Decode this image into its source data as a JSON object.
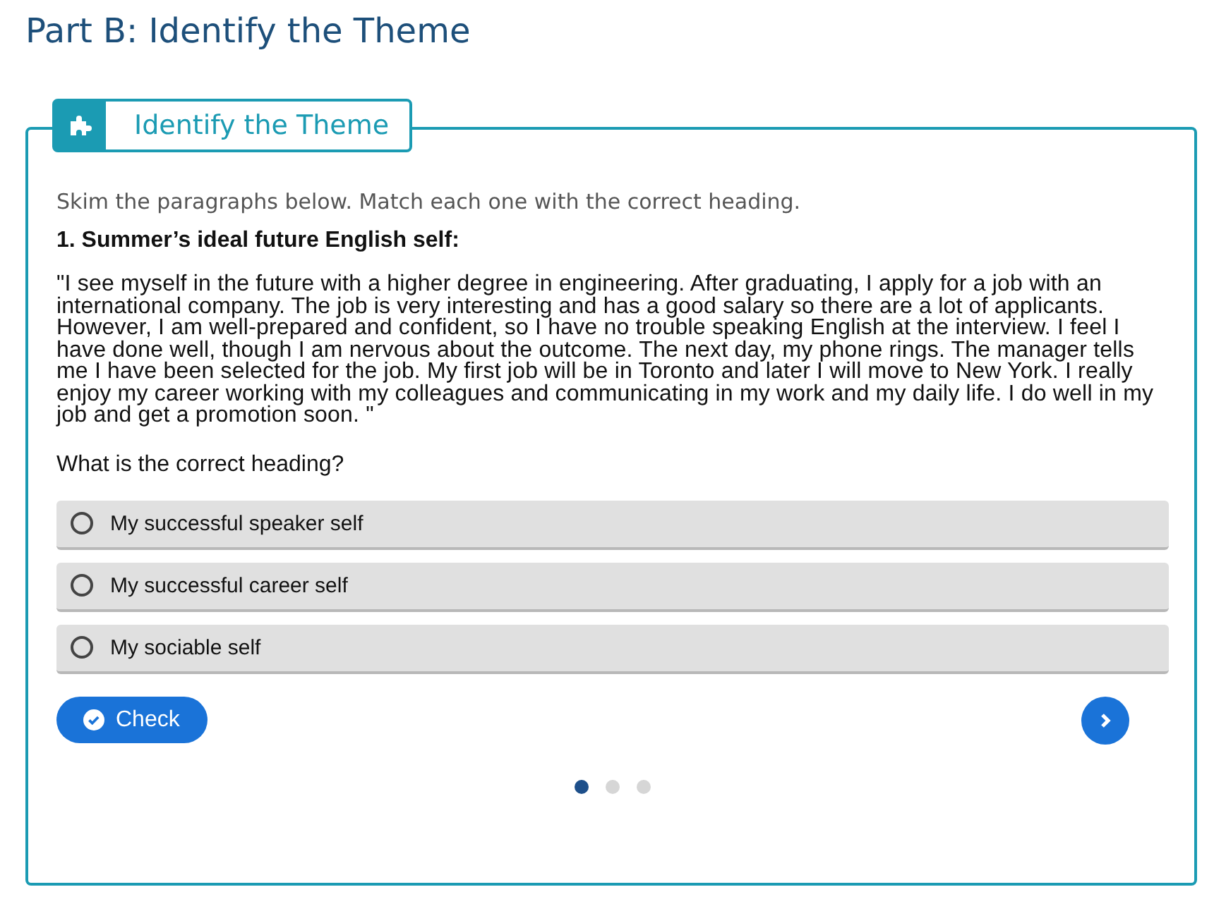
{
  "page_title": "Part B: Identify the Theme",
  "activity": {
    "title": "Identify the Theme",
    "instruction": "Skim the paragraphs below. Match each one with the correct heading.",
    "question_title": "1. Summer’s ideal future English self:",
    "passage": "\"I see myself in the future with a higher degree in engineering. After graduating, I apply for a job with an international company. The job is very interesting and has a good salary so there are a lot of applicants. However, I am well-prepared and confident, so I have no trouble speaking English at the interview. I feel I have done well, though I am nervous about the outcome. The next day, my phone rings. The manager tells me I have been selected for the job. My first job will be in Toronto and later I will move to New York. I really enjoy my career working with my colleagues and communicating in my work and my daily life. I do well in my job and get a promotion soon. \"",
    "prompt": "What is the correct heading?",
    "options": [
      {
        "label": "My successful speaker self",
        "selected": false
      },
      {
        "label": "My successful career self",
        "selected": false
      },
      {
        "label": "My sociable self",
        "selected": false
      }
    ],
    "check_button": "Check",
    "pages": [
      {
        "selected": true
      },
      {
        "selected": false
      },
      {
        "selected": false
      }
    ]
  }
}
